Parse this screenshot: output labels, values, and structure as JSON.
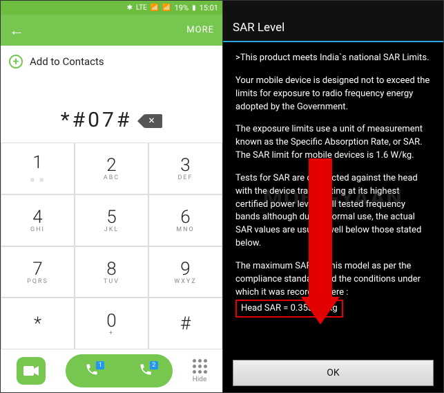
{
  "status": {
    "battery": "19%",
    "time": "15:01",
    "lte": "LTE"
  },
  "header": {
    "more": "MORE"
  },
  "dialer": {
    "add_contacts": "Add to Contacts",
    "dialed": "*#07#",
    "keys": [
      {
        "n": "1",
        "s": " "
      },
      {
        "n": "2",
        "s": "ABC"
      },
      {
        "n": "3",
        "s": "DEF"
      },
      {
        "n": "4",
        "s": "GHI"
      },
      {
        "n": "5",
        "s": "JKL"
      },
      {
        "n": "6",
        "s": "MNO"
      },
      {
        "n": "7",
        "s": "PQRS"
      },
      {
        "n": "8",
        "s": "TUV"
      },
      {
        "n": "9",
        "s": "WXYZ"
      },
      {
        "n": "*",
        "s": ""
      },
      {
        "n": "0",
        "s": "+"
      },
      {
        "n": "#",
        "s": ""
      }
    ],
    "key1_sub": " ",
    "sim1_badge": "1",
    "sim2_badge": "2",
    "hide": "Hide"
  },
  "sar": {
    "title": "SAR Level",
    "p1": ">This product meets India`s national SAR Limits.",
    "p2": "Your mobile device is designed not to exceed the limits for exposure to radio frequency energy adopted by the Government.",
    "p3": "The exposure limits use a unit of measurement known as the Specific Absorption Rate, or SAR.\nThe SAR limit for mobile devices is 1.6 W/kg.",
    "p4": "Tests for SAR are conducted against the head with the device transmitting at its highest certified power level in all tested frequency bands although during normal use, the actual SAR values are usually well below those stated below.",
    "p5_pre": "The maximum SAR for this model as per the compliance standard and the conditions under which it was recorded were : ",
    "head_sar": "Head SAR = 0.353 W/Kg",
    "ok": "OK"
  },
  "watermark": "MOBIGYAAN"
}
